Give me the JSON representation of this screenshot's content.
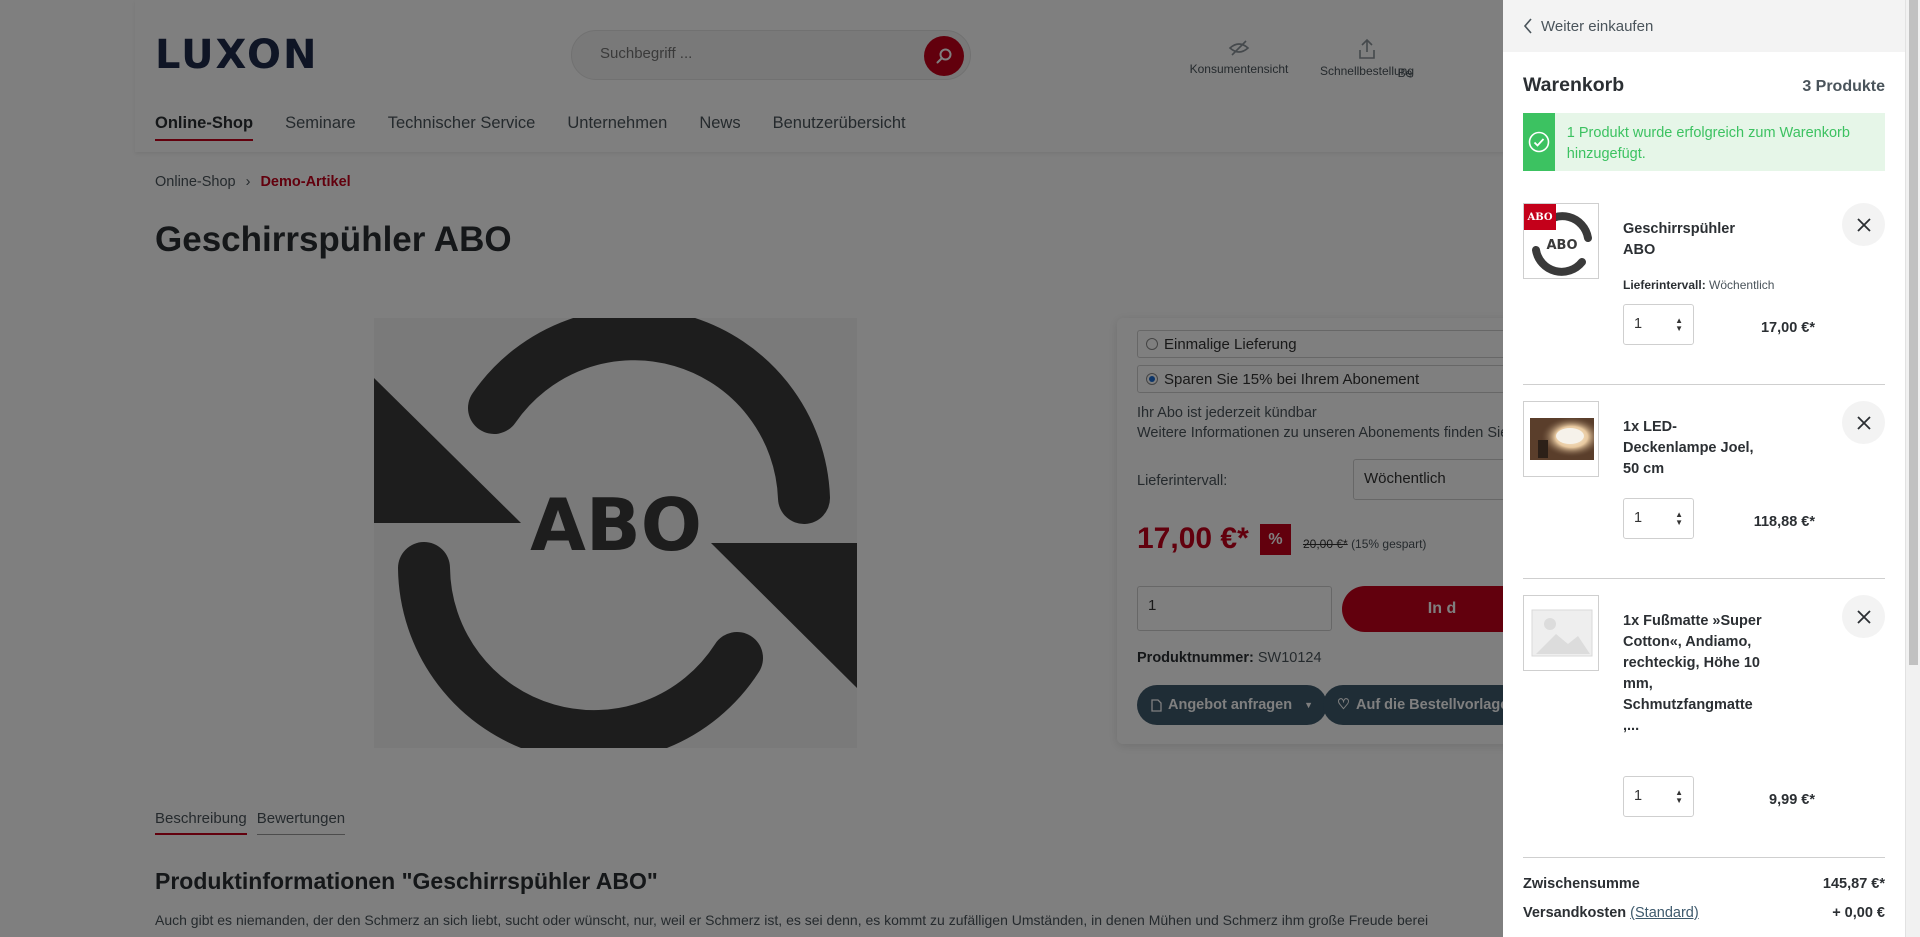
{
  "header": {
    "logo": "LUXON",
    "search_placeholder": "Suchbegriff ...",
    "icons": [
      {
        "label": "Konsumentensicht",
        "icon": "eye-slash-icon"
      },
      {
        "label": "Schnellbestellung",
        "icon": "share-upload-icon"
      },
      {
        "label": "Be",
        "icon": "partial-icon"
      }
    ]
  },
  "nav": [
    "Online-Shop",
    "Seminare",
    "Technischer Service",
    "Unternehmen",
    "News",
    "Benutzerübersicht"
  ],
  "breadcrumb": {
    "home": "Online-Shop",
    "separator": "›",
    "current": "Demo-Artikel"
  },
  "product": {
    "title": "Geschirrspühler ABO",
    "image_text": "ABO",
    "option_once": "Einmalige Lieferung",
    "option_abo": "Sparen Sie 15% bei Ihrem Abonement",
    "abo_info_1": "Ihr Abo ist jederzeit kündbar",
    "abo_info_2": "Weitere Informationen zu unseren Abonements finden Sie",
    "interval_label": "Lieferintervall:",
    "interval_value": "Wöchentlich",
    "price": "17,00 €*",
    "badge": "%",
    "old_price": "20,00 €*",
    "saving": "(15% gespart)",
    "qty": "1",
    "add_to_cart": "In d",
    "number_label": "Produktnummer:",
    "number_value": "SW10124",
    "btn_offer": "Angebot anfragen",
    "btn_order_template": "Auf die Bestellvorlage"
  },
  "tabs": [
    "Beschreibung",
    "Bewertungen"
  ],
  "content": {
    "heading": "Produktinformationen \"Geschirrspühler ABO\"",
    "paragraph": "Auch gibt es niemanden, der den Schmerz an sich liebt, sucht oder wünscht, nur, weil er Schmerz ist, es sei denn, es kommt zu zufälligen Umständen, in denen Mühen und Schmerz ihm große Freude berei"
  },
  "cart": {
    "back": "Weiter einkaufen",
    "title": "Warenkorb",
    "count": "3 Produkte",
    "success": "1 Produkt wurde erfolgreich zum Warenkorb hinzugefügt.",
    "items": [
      {
        "name": "Geschirrspühler ABO",
        "meta_label": "Lieferintervall:",
        "meta_value": "Wöchentlich",
        "qty": "1",
        "price": "17,00 €*",
        "thumb": "abo"
      },
      {
        "name": "1x LED-Deckenlampe Joel, 50 cm",
        "qty": "1",
        "price": "118,88 €*",
        "thumb": "lamp"
      },
      {
        "name": "1x Fußmatte »Super Cotton«, Andiamo, rechteckig, Höhe 10 mm, Schmutzfangmatte ,...",
        "qty": "1",
        "price": "9,99 €*",
        "thumb": "placeholder"
      }
    ],
    "subtotal_label": "Zwischensumme",
    "subtotal_value": "145,87 €*",
    "shipping_label": "Versandkosten",
    "shipping_link": "(Standard)",
    "shipping_value": "+ 0,00 €"
  },
  "colors": {
    "brand_red": "#c4001a",
    "success_green": "#3cc261",
    "navy": "#1e2a4a",
    "pill": "#3e5a6d"
  }
}
